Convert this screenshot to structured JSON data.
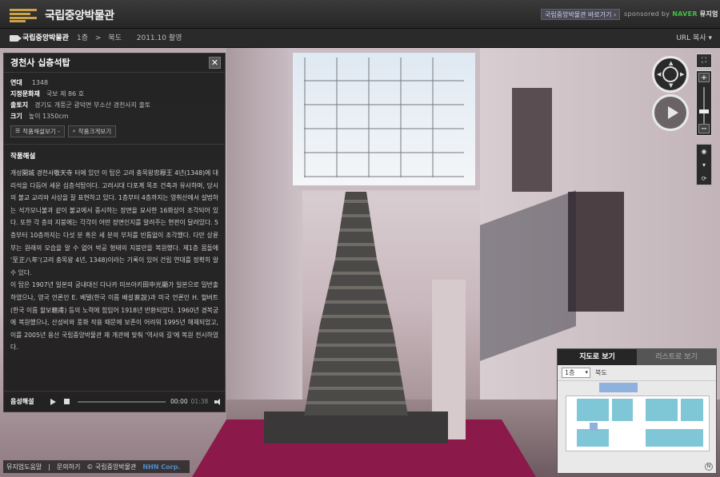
{
  "app": {
    "title": "국립중앙박물관",
    "shortcut_label": "국립중앙박물관 바로가기 ›",
    "sponsored_prefix": "sponsored by",
    "sponsor_brand": "NAVER",
    "sponsor_product": "뮤지엄"
  },
  "navbar": {
    "home_label": "국립중앙박물관",
    "breadcrumbs": [
      "1층",
      ">",
      "북도",
      "2011.10 촬영"
    ],
    "url_copy_label": "URL 복사 ▾"
  },
  "panel": {
    "title": "경천사 십층석탑",
    "close_label": "✕",
    "meta": [
      {
        "key": "연대",
        "value": "1348"
      },
      {
        "key": "지정문화재",
        "value": "국보 제 86 호"
      },
      {
        "key": "출토지",
        "value": "경기도 개풍군 광덕면 부소산 경천사지 출토"
      },
      {
        "key": "크기",
        "value": "높이 1350cm"
      }
    ],
    "buttons": [
      {
        "icon": "☰",
        "label": "작품해설보기 -"
      },
      {
        "icon": "⌕",
        "label": "작품크게보기"
      }
    ],
    "commentary_title": "작품해설",
    "commentary": "개성開城 경천사敬天寺 터에 있던 이 탑은 고려 충목왕忠穆王 4년(1348)에 대리석을 다듬어 세운 십층석탑이다. 고려시대 다포계 목조 건축과 유사하며, 당시의 불교 교리와 사상을 잘 표현하고 있다. 1층부터 4층까지는 영취산에서 설법하는 석가모니불과 같이 불교에서 중시하는 장면을 묘사한 16화상이 조각되어 있다. 또한 각 층의 지붕에는 각각이 어떤 장면인지를 알려주는 현판이 달려있다. 5층부터 10층까지는 다섯 분 혹은 세 분의 부처를 빈틈없이 조각했다. 다만 상륜부는 원래의 모습을 알 수 없어 박공 형태의 지붕만을 복원했다. 제1층 몸돌에 '至正八年'(고려 충목왕 4년, 1348)이라는 기록이 있어 건립 연대를 정확히 알 수 있다.\n이 탑은 1907년 일본의 궁내대신 다나카 미쓰아키田中光顯가 일본으로 밀반출하였으나, 영국 언론인 E. 베델(한국 이름 배설裵說)과 미국 언론인 H. 헐버트(한국 이름 할보轄甫) 등의 노력에 힘입어 1918년 반환되었다. 1960년 경복궁에 복원했으나, 산성비와 풍화 작용 때문에 보존이 어려워 1995년 해체되었고, 이를 2005년 용산 국립중앙박물관 재 개관에 맞춰 '역사의 길'에 복원 전시하였다.",
    "audio": {
      "label": "음성해설",
      "current_time": "00:00",
      "duration": "01:38"
    }
  },
  "controls": {
    "fullscreen_icon": "⛶",
    "zoom_in": "+",
    "zoom_out": "−",
    "zoom_level": 0.35,
    "tools": [
      "◉",
      "▾",
      "⟳"
    ]
  },
  "map": {
    "tab_map": "지도로 보기",
    "tab_list": "리스트로 보기",
    "floor": "1층",
    "location": "북도",
    "compass": "N"
  },
  "footer": {
    "links": [
      "뮤지엄도움말",
      "|",
      "문의하기",
      "© 국립중앙박물관"
    ],
    "brand": "NHN Corp."
  }
}
